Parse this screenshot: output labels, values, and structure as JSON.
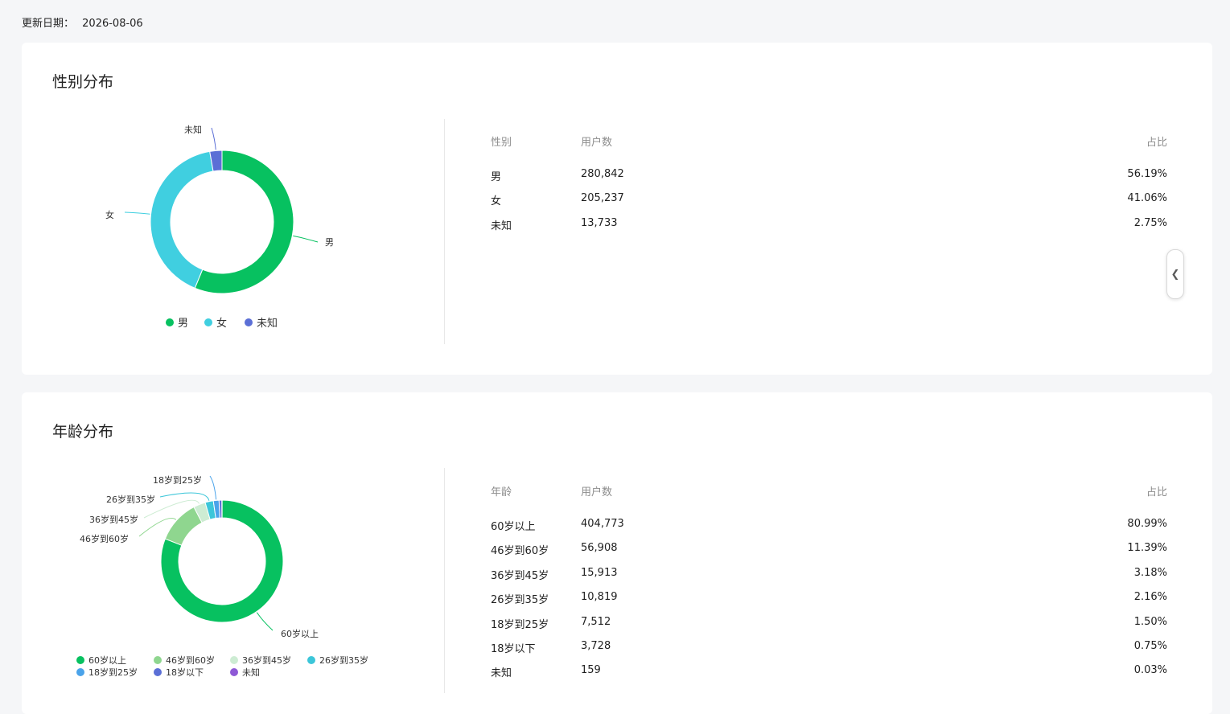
{
  "update": {
    "label": "更新日期：",
    "date": "2026-08-06"
  },
  "gender_section": {
    "title": "性别分布",
    "table": {
      "headers": [
        "性别",
        "用户数",
        "占比"
      ],
      "rows": [
        [
          "男",
          "280,842",
          "56.19%"
        ],
        [
          "女",
          "205,237",
          "41.06%"
        ],
        [
          "未知",
          "13,733",
          "2.75%"
        ]
      ]
    }
  },
  "age_section": {
    "title": "年龄分布",
    "table": {
      "headers": [
        "年龄",
        "用户数",
        "占比"
      ],
      "rows": [
        [
          "60岁以上",
          "404,773",
          "80.99%"
        ],
        [
          "46岁到60岁",
          "56,908",
          "11.39%"
        ],
        [
          "36岁到45岁",
          "15,913",
          "3.18%"
        ],
        [
          "26岁到35岁",
          "10,819",
          "2.16%"
        ],
        [
          "18岁到25岁",
          "7,512",
          "1.50%"
        ],
        [
          "18岁以下",
          "3,728",
          "0.75%"
        ],
        [
          "未知",
          "159",
          "0.03%"
        ]
      ]
    }
  },
  "chart_data": [
    {
      "type": "pie",
      "donut": true,
      "categories": [
        "男",
        "女",
        "未知"
      ],
      "values": [
        56.19,
        41.06,
        2.75
      ],
      "colors": [
        "#07c160",
        "#40cfe0",
        "#5b6fd6"
      ],
      "legend": "bottom"
    },
    {
      "type": "pie",
      "donut": true,
      "categories": [
        "60岁以上",
        "46岁到60岁",
        "36岁到45岁",
        "26岁到35岁",
        "18岁到25岁",
        "18岁以下",
        "未知"
      ],
      "values": [
        80.99,
        11.39,
        3.18,
        2.16,
        1.5,
        0.75,
        0.03
      ],
      "colors": [
        "#07c160",
        "#8fd68f",
        "#cdecd3",
        "#3cc6d9",
        "#4aa3ea",
        "#5b6fd6",
        "#8e59d6"
      ],
      "labeled": [
        "60岁以上",
        "46岁到60岁",
        "36岁到45岁",
        "26岁到35岁",
        "18岁到25岁"
      ],
      "legend": "bottom"
    }
  ],
  "ui": {
    "side_handle_icon": "chevron-left-icon"
  }
}
